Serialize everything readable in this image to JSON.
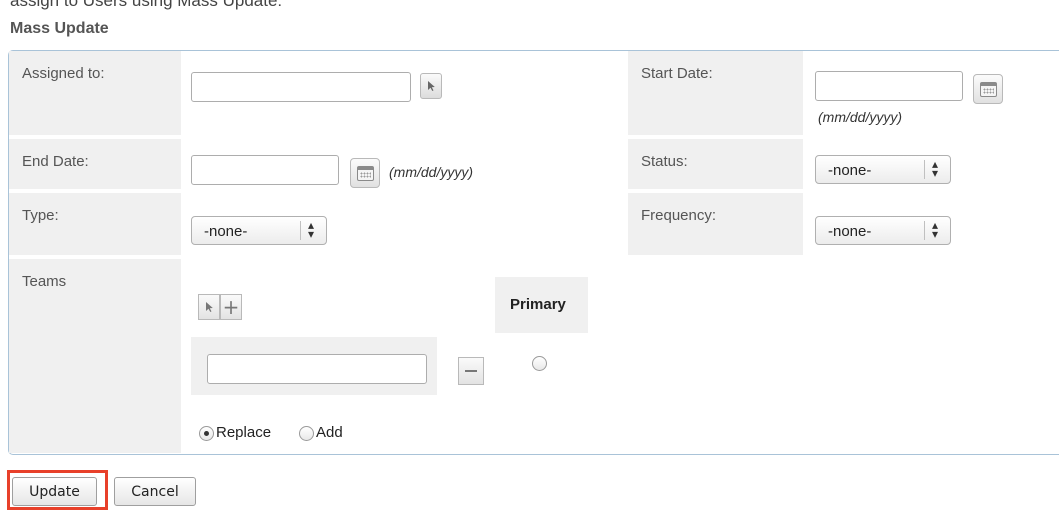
{
  "header": {
    "partial_text": "assign to Users using Mass Update:",
    "title": "Mass Update"
  },
  "fields": {
    "assigned_to": {
      "label": "Assigned to:",
      "value": ""
    },
    "start_date": {
      "label": "Start Date:",
      "value": "",
      "format_hint": "(mm/dd/yyyy)"
    },
    "end_date": {
      "label": "End Date:",
      "value": "",
      "format_hint": "(mm/dd/yyyy)"
    },
    "status": {
      "label": "Status:",
      "selected": "-none-"
    },
    "type": {
      "label": "Type:",
      "selected": "-none-"
    },
    "frequency": {
      "label": "Frequency:",
      "selected": "-none-"
    },
    "teams": {
      "label": "Teams",
      "primary_label": "Primary",
      "team_value": "",
      "primary_selected": false,
      "mode_options": [
        {
          "label": "Replace",
          "checked": true
        },
        {
          "label": "Add",
          "checked": false
        }
      ]
    }
  },
  "icons": {
    "select_arrow": "cursor-arrow-icon",
    "add": "plus-icon",
    "remove": "minus-icon",
    "calendar": "calendar-icon",
    "dropdown": "updown-chevron-icon"
  },
  "buttons": {
    "update": "Update",
    "cancel": "Cancel"
  },
  "colors": {
    "label_bg": "#f0f0f0",
    "panel_border": "#a9c3d8",
    "highlight": "#e8402a"
  }
}
